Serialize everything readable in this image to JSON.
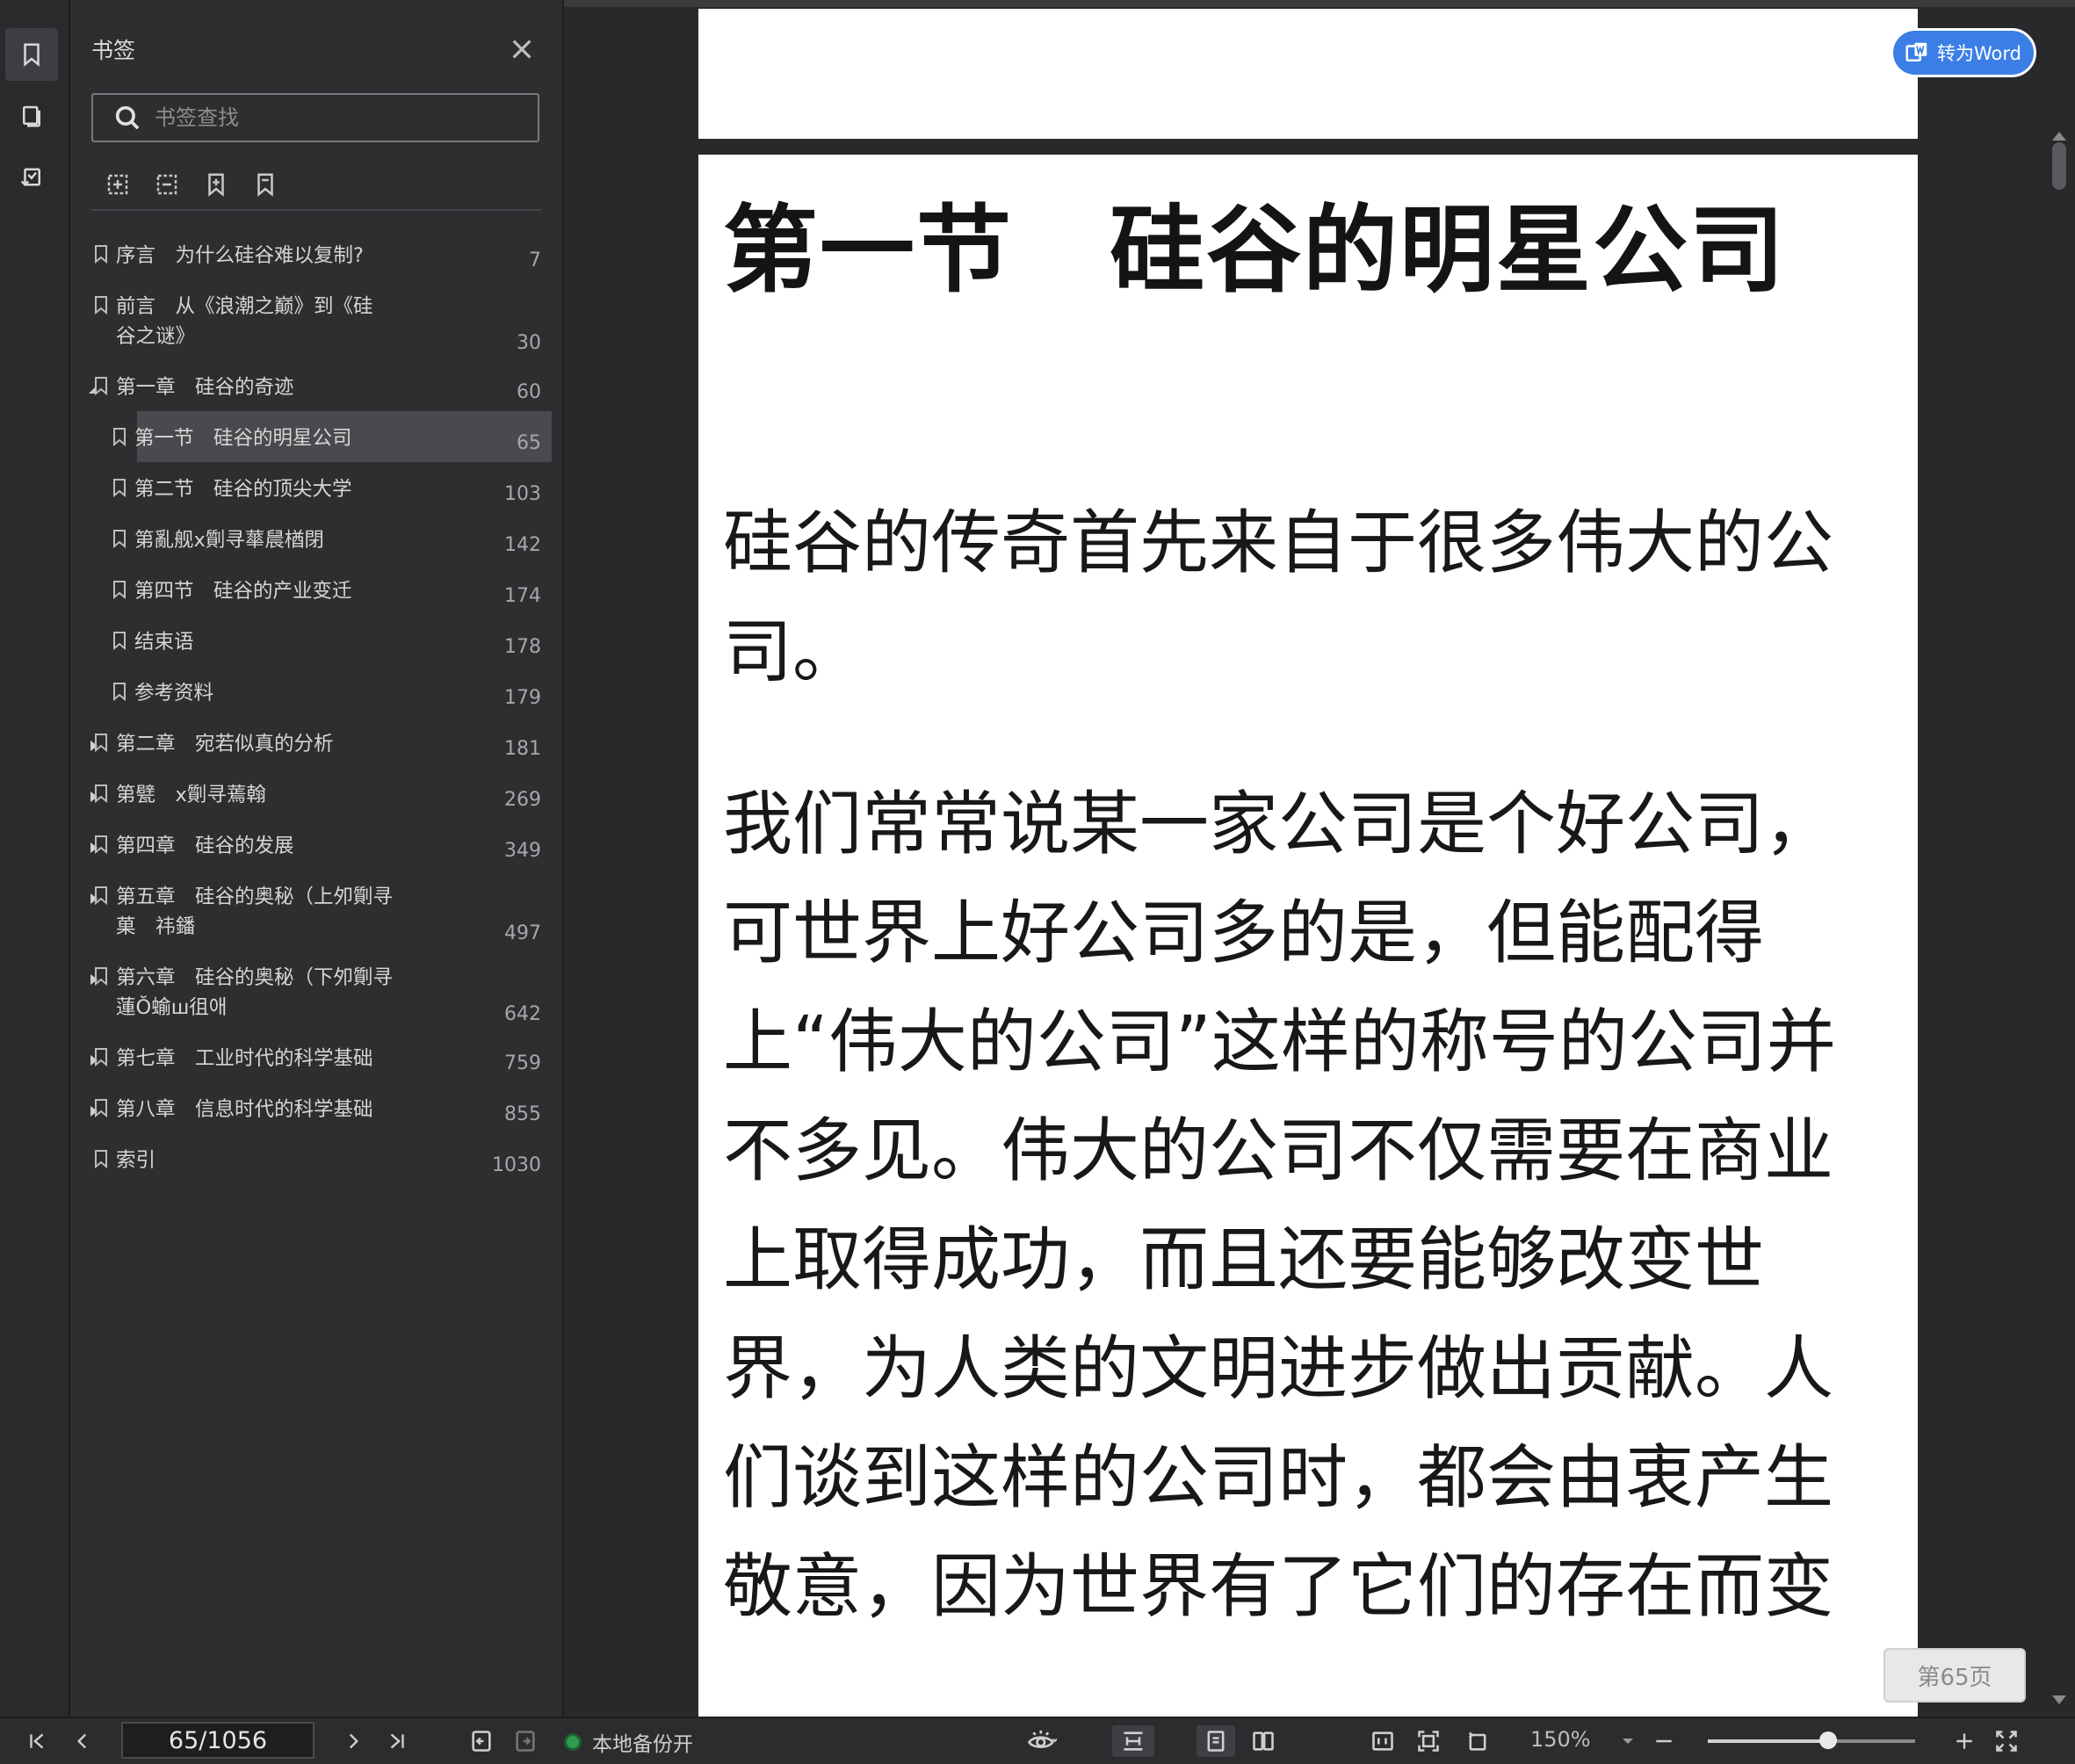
{
  "sidebar_rail": {
    "items": [
      {
        "name": "bookmark-icon",
        "active": true
      },
      {
        "name": "thumbnail-icon",
        "active": false
      },
      {
        "name": "annotation-icon",
        "active": false
      }
    ]
  },
  "bookmark_panel": {
    "title": "书签",
    "search_placeholder": "书签查找",
    "tools": [
      "expand-all-icon",
      "collapse-all-icon",
      "add-bookmark-icon",
      "bookmark-icon"
    ],
    "items": [
      {
        "label": "序言　为什么硅谷难以复制?",
        "page": "7",
        "level": 0,
        "arrow": "none"
      },
      {
        "label": "前言　从《浪潮之巅》到《硅\n谷之谜》",
        "page": "30",
        "level": 0,
        "arrow": "none"
      },
      {
        "label": "第一章　硅谷的奇迹",
        "page": "60",
        "level": 0,
        "arrow": "expanded"
      },
      {
        "label": "第一节　硅谷的明星公司",
        "page": "65",
        "level": 1,
        "arrow": "none",
        "selected": true
      },
      {
        "label": "第二节　硅谷的顶尖大学",
        "page": "103",
        "level": 1,
        "arrow": "none"
      },
      {
        "label": "第亂舰x劕寻蕐䢅楢閉",
        "page": "142",
        "level": 1,
        "arrow": "none"
      },
      {
        "label": "第四节　硅谷的产业变迁",
        "page": "174",
        "level": 1,
        "arrow": "none"
      },
      {
        "label": "结束语",
        "page": "178",
        "level": 1,
        "arrow": "none"
      },
      {
        "label": "参考资料",
        "page": "179",
        "level": 1,
        "arrow": "none"
      },
      {
        "label": "第二章　宛若似真的分析",
        "page": "181",
        "level": 0,
        "arrow": "collapsed"
      },
      {
        "label": "第甓　x劕寻蔫翰",
        "page": "269",
        "level": 0,
        "arrow": "collapsed"
      },
      {
        "label": "第四章　硅谷的发展",
        "page": "349",
        "level": 0,
        "arrow": "collapsed"
      },
      {
        "label": "第五章　硅谷的奥秘（上夘劕寻\n菓　祎鐇",
        "page": "497",
        "level": 0,
        "arrow": "collapsed"
      },
      {
        "label": "第六章　硅谷的奥秘（下夘劕寻\n蓮Ŏ蝓ꟺ徂애",
        "page": "642",
        "level": 0,
        "arrow": "collapsed"
      },
      {
        "label": "第七章　工业时代的科学基础",
        "page": "759",
        "level": 0,
        "arrow": "collapsed"
      },
      {
        "label": "第八章　信息时代的科学基础",
        "page": "855",
        "level": 0,
        "arrow": "collapsed"
      },
      {
        "label": "索引",
        "page": "1030",
        "level": 0,
        "arrow": "none"
      }
    ]
  },
  "document": {
    "section_title": "第一节　硅谷的明星公司",
    "paragraph_1": "硅谷的传奇首先来自于很多伟大的公司。",
    "paragraph_2": "我们常常说某一家公司是个好公司，可世界上好公司多的是，但能配得上“伟大的公司”这样的称号的公司并不多见。伟大的公司不仅需要在商业上取得成功，而且还要能够改变世界，为人类的文明进步做出贡献。人们谈到这样的公司时，都会由衷产生敬意，因为世界有了它们的存在而变",
    "convert_button": "转为Word",
    "page_badge": "第65页"
  },
  "status_bar": {
    "page_indicator": "65/1056",
    "backup_label": "本地备份开",
    "zoom_label": "150%",
    "zoom_level": 0.58,
    "accent_color": "#3b7fe6",
    "backup_color": "#2f9d4e"
  }
}
